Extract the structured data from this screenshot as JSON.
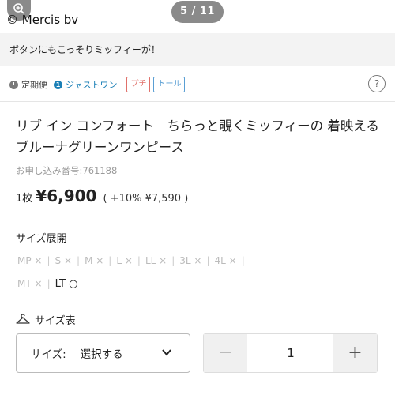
{
  "gallery": {
    "credit": "© Mercis bv",
    "counter": "5 / 11",
    "caption": "ボタンにもこっそりミッフィーが！"
  },
  "delivery": {
    "regular": "定期便",
    "just_one": "ジャストワン",
    "badge_one": "1",
    "tag_petit": "プチ",
    "tag_tall": "トール",
    "help": "?"
  },
  "product": {
    "title": "リブ イン コンフォート　ちらっと覗くミッフィーの 着映えるブルーナグリーンワンピース",
    "order_no": "お申し込み番号:761188",
    "unit": "1枚",
    "price": "¥6,900",
    "tax_price": "( +10% ¥7,590 )"
  },
  "sizes": {
    "heading": "サイズ展開",
    "row1": [
      "MP ×",
      "S ×",
      "M ×",
      "L ×",
      "LL ×",
      "3L ×",
      "4L ×"
    ],
    "row2_unavailable": "MT ×",
    "row2_available": "LT ○",
    "chart_link": "サイズ表"
  },
  "controls": {
    "size_label": "サイズ:",
    "size_value": "選択する",
    "qty_minus": "−",
    "qty_value": "1",
    "qty_plus": "+"
  },
  "colors": {
    "accent_blue": "#1a7fb6",
    "petit_red": "#e0706a",
    "tall_blue": "#5a9fd4"
  }
}
